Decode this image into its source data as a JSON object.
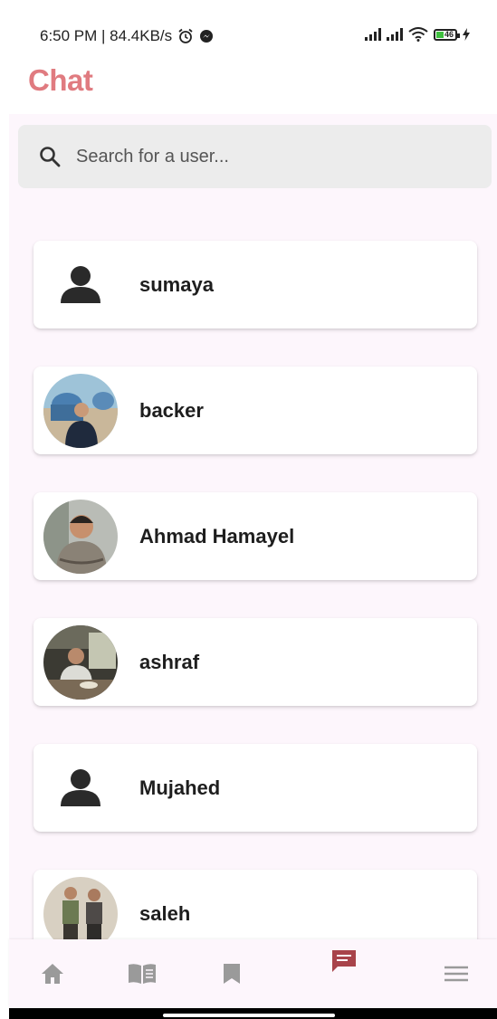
{
  "status_bar": {
    "time_speed": "6:50 PM | 84.4KB/s",
    "battery": "46"
  },
  "header": {
    "title": "Chat"
  },
  "search": {
    "placeholder": "Search for a user..."
  },
  "users": [
    {
      "name": "sumaya",
      "avatar": "person-icon"
    },
    {
      "name": "backer",
      "avatar": "photo"
    },
    {
      "name": "Ahmad Hamayel",
      "avatar": "photo"
    },
    {
      "name": "ashraf",
      "avatar": "photo"
    },
    {
      "name": "Mujahed",
      "avatar": "person-icon"
    },
    {
      "name": "saleh",
      "avatar": "photo"
    }
  ],
  "bottom_nav": [
    {
      "icon": "home-icon",
      "active": false
    },
    {
      "icon": "book-icon",
      "active": false
    },
    {
      "icon": "bookmark-icon",
      "active": false
    },
    {
      "icon": "chat-icon",
      "active": true
    },
    {
      "icon": "menu-icon",
      "active": false
    }
  ],
  "colors": {
    "accent": "#e07b80",
    "active_nav": "#a8434a",
    "inactive_nav": "#9a9a9a",
    "background": "#fdf6fc"
  }
}
